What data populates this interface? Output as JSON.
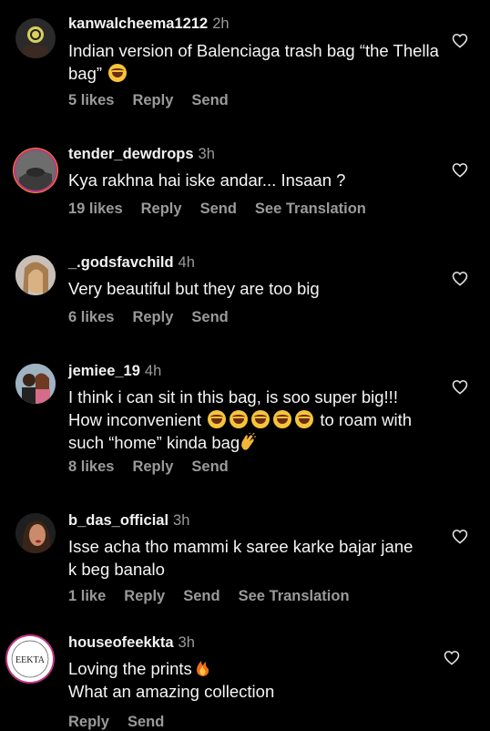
{
  "comments": [
    {
      "username": "kanwalcheema1212",
      "time": "2h",
      "text": "Indian version of Balenciaga trash bag “the Thella bag”",
      "emoji": "laughing-emoji",
      "likes": "5 likes",
      "reply": "Reply",
      "send": "Send",
      "translation": ""
    },
    {
      "username": "tender_dewdrops",
      "time": "3h",
      "text": "Kya rakhna hai iske andar... Insaan ?",
      "likes": "19 likes",
      "reply": "Reply",
      "send": "Send",
      "translation": "See Translation"
    },
    {
      "username": "_.godsfavchild",
      "time": "4h",
      "text": "Very beautiful but they are too big",
      "likes": "6 likes",
      "reply": "Reply",
      "send": "Send",
      "translation": ""
    },
    {
      "username": "jemiee_19",
      "time": "4h",
      "text_a": "I think i can sit in this bag, is soo super big!!! How inconvenient",
      "text_b": "to roam with such “home” kinda bag",
      "likes": "8 likes",
      "reply": "Reply",
      "send": "Send",
      "translation": ""
    },
    {
      "username": "b_das_official",
      "time": "3h",
      "text": "Isse acha tho mammi k saree karke bajar jane k beg banalo",
      "likes": "1 like",
      "reply": "Reply",
      "send": "Send",
      "translation": "See Translation"
    },
    {
      "username": "houseofeekkta",
      "time": "3h",
      "text_a": "Loving the prints",
      "text_b": "What an amazing collection",
      "reply": "Reply",
      "send": "Send",
      "logo_text": "EEKTA"
    }
  ],
  "colors": {
    "background": "#000000",
    "text": "#f5f5f5",
    "muted": "#9a9a9a",
    "story_ring": "#c13584"
  }
}
